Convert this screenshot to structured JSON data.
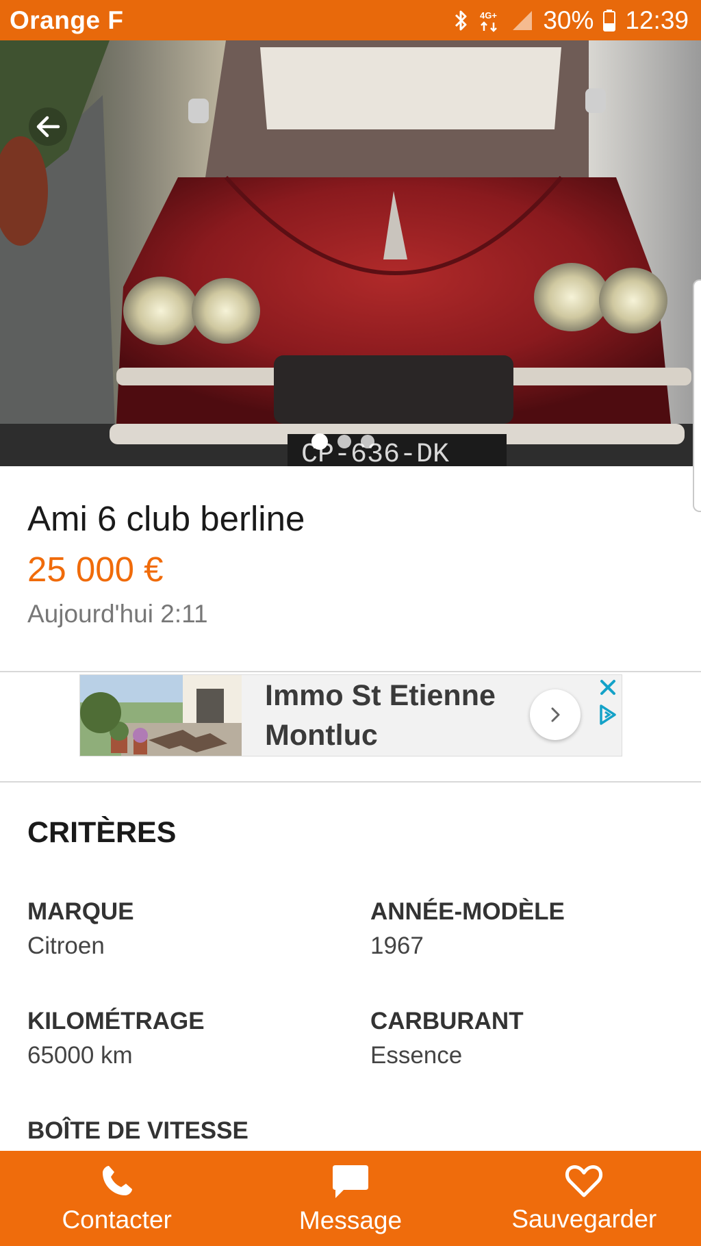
{
  "status_bar": {
    "carrier": "Orange F",
    "network": "4G+",
    "battery": "30%",
    "time": "12:39"
  },
  "hero": {
    "photo_count": 3,
    "active_photo": 1,
    "plate_text": "CP-636-DK"
  },
  "listing": {
    "title": "Ami 6 club berline",
    "price": "25 000 €",
    "date": "Aujourd'hui 2:11"
  },
  "ad": {
    "text": "Immo St Etienne Montluc"
  },
  "criteria": {
    "heading": "CRITÈRES",
    "items": [
      {
        "label": "MARQUE",
        "value": "Citroen"
      },
      {
        "label": "ANNÉE-MODÈLE",
        "value": "1967"
      },
      {
        "label": "KILOMÉTRAGE",
        "value": "65000 km"
      },
      {
        "label": "CARBURANT",
        "value": "Essence"
      },
      {
        "label": "BOÎTE DE VITESSE",
        "value": ""
      }
    ]
  },
  "actions": {
    "contact": "Contacter",
    "message": "Message",
    "save": "Sauvegarder"
  },
  "colors": {
    "brand": "#ef6c0c",
    "price": "#f06b0a"
  }
}
